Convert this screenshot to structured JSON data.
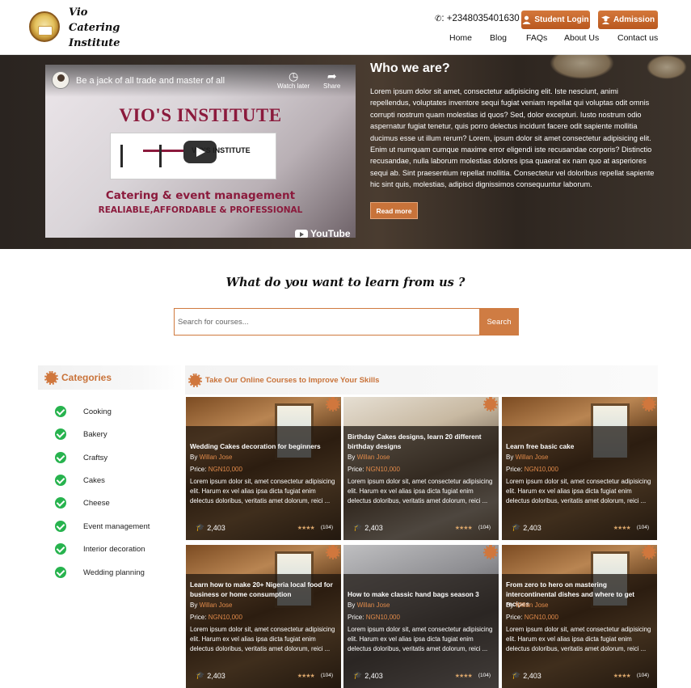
{
  "header": {
    "brand_lines": [
      "Vio",
      "Catering",
      "Institute"
    ],
    "phone_icon": "phone-icon",
    "phone": ": +2348035401630",
    "student_login": "Student Login",
    "admission": "Admission",
    "nav": [
      "Home",
      "Blog",
      "FAQs",
      "About Us",
      "Contact us"
    ]
  },
  "video": {
    "title": "Be a jack of all trade and master of all",
    "watch_later": "Watch later",
    "share": "Share",
    "heading": "VIO'S INSTITUTE",
    "logo_text": "VIO'S INSTITUTE",
    "line1": "Catering & event management",
    "line2": "REALIABLE,AFFORDABLE & PROFESSIONAL",
    "youtube": "YouTube"
  },
  "who": {
    "title": "Who we are?",
    "body": "Lorem ipsum dolor sit amet, consectetur adipisicing elit. Iste nesciunt, animi repellendus, voluptates inventore sequi fugiat veniam repellat qui voluptas odit omnis corrupti nostrum quam molestias id quos? Sed, dolor excepturi. Iusto nostrum odio aspernatur fugiat tenetur, quis porro delectus incidunt facere odit sapiente mollitia ducimus esse ut illum rerum? Lorem, ipsum dolor sit amet consectetur adipisicing elit. Enim ut numquam cumque maxime error eligendi iste recusandae corporis? Distinctio recusandae, nulla laborum molestias dolores ipsa quaerat ex nam quo at asperiores sequi ab. Sint praesentium repellat mollitia. Consectetur vel doloribus repellat sapiente hic sint quis, molestias, adipisci dignissimos consequuntur laborum.",
    "read_more": "Read more"
  },
  "learn": {
    "title": "What do you want to learn from us ?",
    "search_placeholder": "Search for courses...",
    "search_button": "Search"
  },
  "categories": {
    "title": "Categories",
    "items": [
      "Cooking",
      "Bakery",
      "Craftsy",
      "Cakes",
      "Cheese",
      "Event management",
      "Interior decoration",
      "Wedding planning"
    ]
  },
  "courses": {
    "title": "Take Our Online Courses to Improve Your Skills",
    "by_label": "By",
    "price_label": "Price:",
    "items": [
      {
        "title": "Wedding Cakes decoration for beginners",
        "author": "Willan Jose",
        "price": "NGN10,000",
        "desc": "Lorem ipsum dolor sit, amet consectetur adipisicing elit. Harum ex vel alias ipsa dicta fugiat enim delectus doloribus, veritatis amet dolorum, reici ...",
        "students": "2,403",
        "rating": 4,
        "reviews": "(104)"
      },
      {
        "title": "Birthday Cakes designs, learn 20 different birthday designs",
        "author": "Willan Jose",
        "price": "NGN10,000",
        "desc": "Lorem ipsum dolor sit, amet consectetur adipisicing elit. Harum ex vel alias ipsa dicta fugiat enim delectus doloribus, veritatis amet dolorum, reici ...",
        "students": "2,403",
        "rating": 4,
        "reviews": "(104)"
      },
      {
        "title": "Learn free basic cake",
        "author": "Willan Jose",
        "price": "NGN10,000",
        "desc": "Lorem ipsum dolor sit, amet consectetur adipisicing elit. Harum ex vel alias ipsa dicta fugiat enim delectus doloribus, veritatis amet dolorum, reici ...",
        "students": "2,403",
        "rating": 4,
        "reviews": "(104)"
      },
      {
        "title": "Learn how to make 20+ Nigeria local food for business or home consumption",
        "author": "Willan Jose",
        "price": "NGN10,000",
        "desc": "Lorem ipsum dolor sit, amet consectetur adipisicing elit. Harum ex vel alias ipsa dicta fugiat enim delectus doloribus, veritatis amet dolorum, reici ...",
        "students": "2,403",
        "rating": 4,
        "reviews": "(104)"
      },
      {
        "title": "How to make classic hand bags season 3",
        "author": "Willan Jose",
        "price": "NGN10,000",
        "desc": "Lorem ipsum dolor sit, amet consectetur adipisicing elit. Harum ex vel alias ipsa dicta fugiat enim delectus doloribus, veritatis amet dolorum, reici ...",
        "students": "2,403",
        "rating": 4,
        "reviews": "(104)"
      },
      {
        "title": "From zero to hero on mastering intercontinental dishes and where to get recipes",
        "author": "Willan Jose",
        "price": "NGN10,000",
        "desc": "Lorem ipsum dolor sit, amet consectetur adipisicing elit. Harum ex vel alias ipsa dicta fugiat enim delectus doloribus, veritatis amet dolorum, reici ...",
        "students": "2,403",
        "rating": 4,
        "reviews": "(104)"
      }
    ]
  },
  "colors": {
    "accent": "#cf7c43",
    "check": "#27b34e",
    "brand_video": "#8b1a3c"
  }
}
